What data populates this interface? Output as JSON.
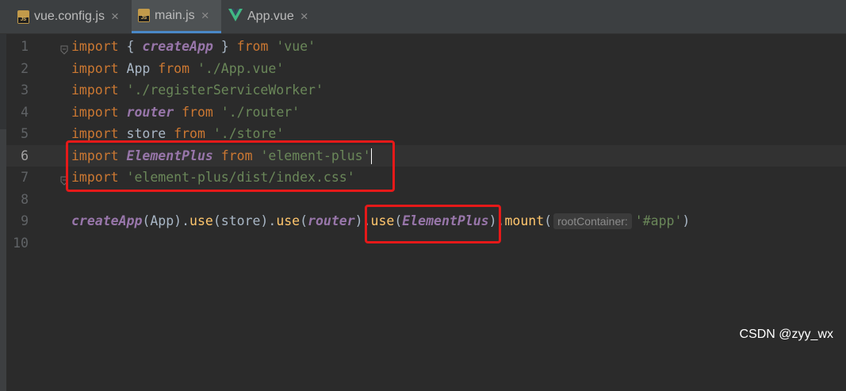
{
  "tabs": [
    {
      "label": "vue.config.js",
      "icon": "js-file-icon",
      "active": false
    },
    {
      "label": "main.js",
      "icon": "js-file-icon",
      "active": true
    },
    {
      "label": "App.vue",
      "icon": "vue-file-icon",
      "active": false
    }
  ],
  "tab_close_glyph": "×",
  "js_icon_label": "JS",
  "current_line": 6,
  "lines": [
    {
      "n": "1",
      "tokens": [
        {
          "t": "import",
          "c": "kw"
        },
        {
          "t": " { ",
          "c": "plain"
        },
        {
          "t": "createApp",
          "c": "fn"
        },
        {
          "t": " } ",
          "c": "plain"
        },
        {
          "t": "from",
          "c": "kw"
        },
        {
          "t": " ",
          "c": "plain"
        },
        {
          "t": "'vue'",
          "c": "str"
        }
      ]
    },
    {
      "n": "2",
      "tokens": [
        {
          "t": "import",
          "c": "kw"
        },
        {
          "t": " App ",
          "c": "plain"
        },
        {
          "t": "from",
          "c": "kw"
        },
        {
          "t": " ",
          "c": "plain"
        },
        {
          "t": "'./App.vue'",
          "c": "str"
        }
      ]
    },
    {
      "n": "3",
      "tokens": [
        {
          "t": "import",
          "c": "kw"
        },
        {
          "t": " ",
          "c": "plain"
        },
        {
          "t": "'./registerServiceWorker'",
          "c": "str"
        }
      ]
    },
    {
      "n": "4",
      "tokens": [
        {
          "t": "import",
          "c": "kw"
        },
        {
          "t": " ",
          "c": "plain"
        },
        {
          "t": "router",
          "c": "fn"
        },
        {
          "t": " ",
          "c": "plain"
        },
        {
          "t": "from",
          "c": "kw"
        },
        {
          "t": " ",
          "c": "plain"
        },
        {
          "t": "'./router'",
          "c": "str"
        }
      ]
    },
    {
      "n": "5",
      "tokens": [
        {
          "t": "import",
          "c": "kw"
        },
        {
          "t": " store ",
          "c": "plain"
        },
        {
          "t": "from",
          "c": "kw"
        },
        {
          "t": " ",
          "c": "plain"
        },
        {
          "t": "'./store'",
          "c": "str"
        }
      ]
    },
    {
      "n": "6",
      "tokens": [
        {
          "t": "import",
          "c": "kw"
        },
        {
          "t": " ",
          "c": "plain"
        },
        {
          "t": "ElementPlus",
          "c": "fn"
        },
        {
          "t": " ",
          "c": "plain"
        },
        {
          "t": "from",
          "c": "kw"
        },
        {
          "t": " ",
          "c": "plain"
        },
        {
          "t": "'element-plus'",
          "c": "str"
        },
        {
          "t": "",
          "c": "caret"
        }
      ]
    },
    {
      "n": "7",
      "tokens": [
        {
          "t": "import",
          "c": "kw"
        },
        {
          "t": " ",
          "c": "plain"
        },
        {
          "t": "'element-plus/dist/index.css'",
          "c": "str"
        }
      ]
    },
    {
      "n": "8",
      "tokens": []
    },
    {
      "n": "9",
      "tokens": [
        {
          "t": "createApp",
          "c": "fn"
        },
        {
          "t": "(App).",
          "c": "plain"
        },
        {
          "t": "use",
          "c": "mth"
        },
        {
          "t": "(store).",
          "c": "plain"
        },
        {
          "t": "use",
          "c": "mth"
        },
        {
          "t": "(",
          "c": "plain"
        },
        {
          "t": "router",
          "c": "fn"
        },
        {
          "t": ").",
          "c": "plain"
        },
        {
          "t": "use",
          "c": "mth"
        },
        {
          "t": "(",
          "c": "plain"
        },
        {
          "t": "ElementPlus",
          "c": "fn"
        },
        {
          "t": ").",
          "c": "plain"
        },
        {
          "t": "mount",
          "c": "mth"
        },
        {
          "t": "(",
          "c": "plain"
        },
        {
          "t": "rootContainer:",
          "c": "hint"
        },
        {
          "t": "'#app'",
          "c": "str"
        },
        {
          "t": ")",
          "c": "plain"
        }
      ]
    },
    {
      "n": "10",
      "tokens": []
    }
  ],
  "colors": {
    "keyword": "#cc7832",
    "string": "#6a8759",
    "identifier": "#9876aa",
    "method": "#ffc66d",
    "text": "#a9b7c6",
    "highlight": "#e61919"
  },
  "watermark": "CSDN @zyy_wx"
}
